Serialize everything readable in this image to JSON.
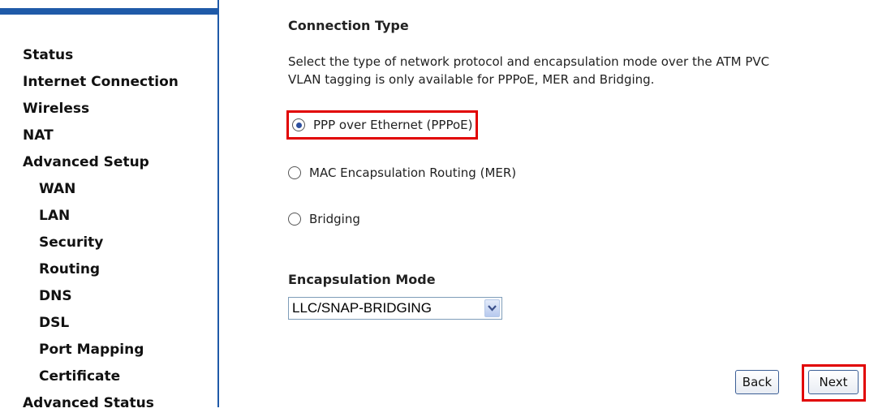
{
  "sidebar": {
    "items": [
      {
        "label": "Status",
        "sub": false
      },
      {
        "label": "Internet Connection",
        "sub": false
      },
      {
        "label": "Wireless",
        "sub": false
      },
      {
        "label": "NAT",
        "sub": false
      },
      {
        "label": "Advanced Setup",
        "sub": false
      },
      {
        "label": "WAN",
        "sub": true
      },
      {
        "label": "LAN",
        "sub": true
      },
      {
        "label": "Security",
        "sub": true
      },
      {
        "label": "Routing",
        "sub": true
      },
      {
        "label": "DNS",
        "sub": true
      },
      {
        "label": "DSL",
        "sub": true
      },
      {
        "label": "Port Mapping",
        "sub": true
      },
      {
        "label": "Certificate",
        "sub": true
      },
      {
        "label": "Advanced Status",
        "sub": false
      }
    ]
  },
  "main": {
    "title": "Connection Type",
    "description_line1": "Select the type of network protocol and encapsulation mode over the ATM PVC",
    "description_line2": "VLAN tagging is only available for PPPoE, MER and Bridging.",
    "options": [
      {
        "label": "PPP over Ethernet (PPPoE)",
        "selected": true
      },
      {
        "label": "MAC Encapsulation Routing (MER)",
        "selected": false
      },
      {
        "label": "Bridging",
        "selected": false
      }
    ],
    "encapsulation_title": "Encapsulation Mode",
    "encapsulation_value": "LLC/SNAP-BRIDGING",
    "back_label": "Back",
    "next_label": "Next"
  },
  "colors": {
    "accent": "#1f5aa8",
    "highlight": "#e10000"
  }
}
